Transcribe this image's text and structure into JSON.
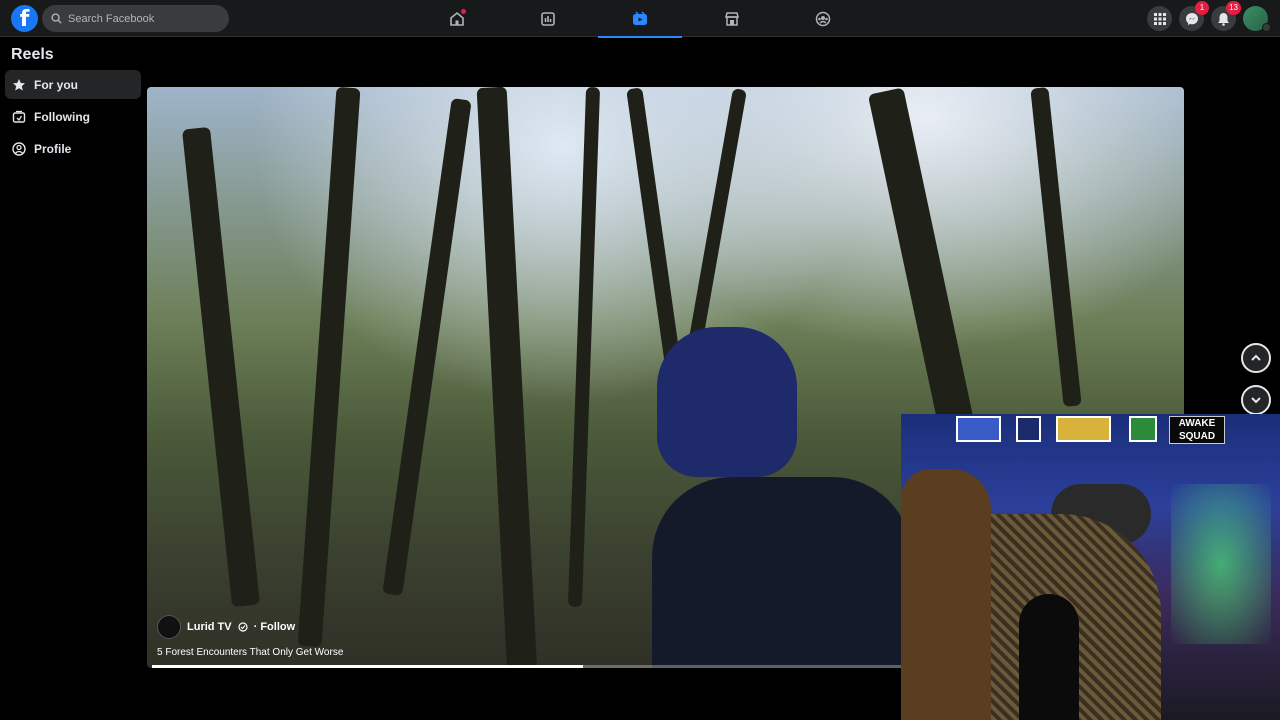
{
  "app": {
    "logo": "facebook-logo"
  },
  "search": {
    "placeholder": "Search Facebook"
  },
  "nav": {
    "tabs": [
      {
        "name": "home",
        "icon": "home-icon",
        "active": false,
        "has_dot": true
      },
      {
        "name": "feeds",
        "icon": "feeds-icon",
        "active": false
      },
      {
        "name": "video",
        "icon": "video-icon",
        "active": true
      },
      {
        "name": "marketplace",
        "icon": "marketplace-icon",
        "active": false
      },
      {
        "name": "groups",
        "icon": "groups-icon",
        "active": false
      }
    ]
  },
  "header_right": {
    "menu_icon": "grid-menu-icon",
    "messenger_badge": "1",
    "notifications_badge": "13"
  },
  "sidebar": {
    "title": "Reels",
    "items": [
      {
        "label": "For you",
        "icon": "star-icon",
        "active": true
      },
      {
        "label": "Following",
        "icon": "following-icon",
        "active": false
      },
      {
        "label": "Profile",
        "icon": "profile-icon",
        "active": false
      }
    ]
  },
  "reel": {
    "channel_name": "Lurid TV",
    "follow_label": "· Follow",
    "caption": "5 Forest Encounters That Only Get Worse",
    "progress": 0.42
  },
  "webcam": {
    "sign_text": "AWAKE SQUAD"
  },
  "colors": {
    "accent": "#2d88ff",
    "badge": "#e41e3f",
    "topbar_bg": "#18191a"
  }
}
